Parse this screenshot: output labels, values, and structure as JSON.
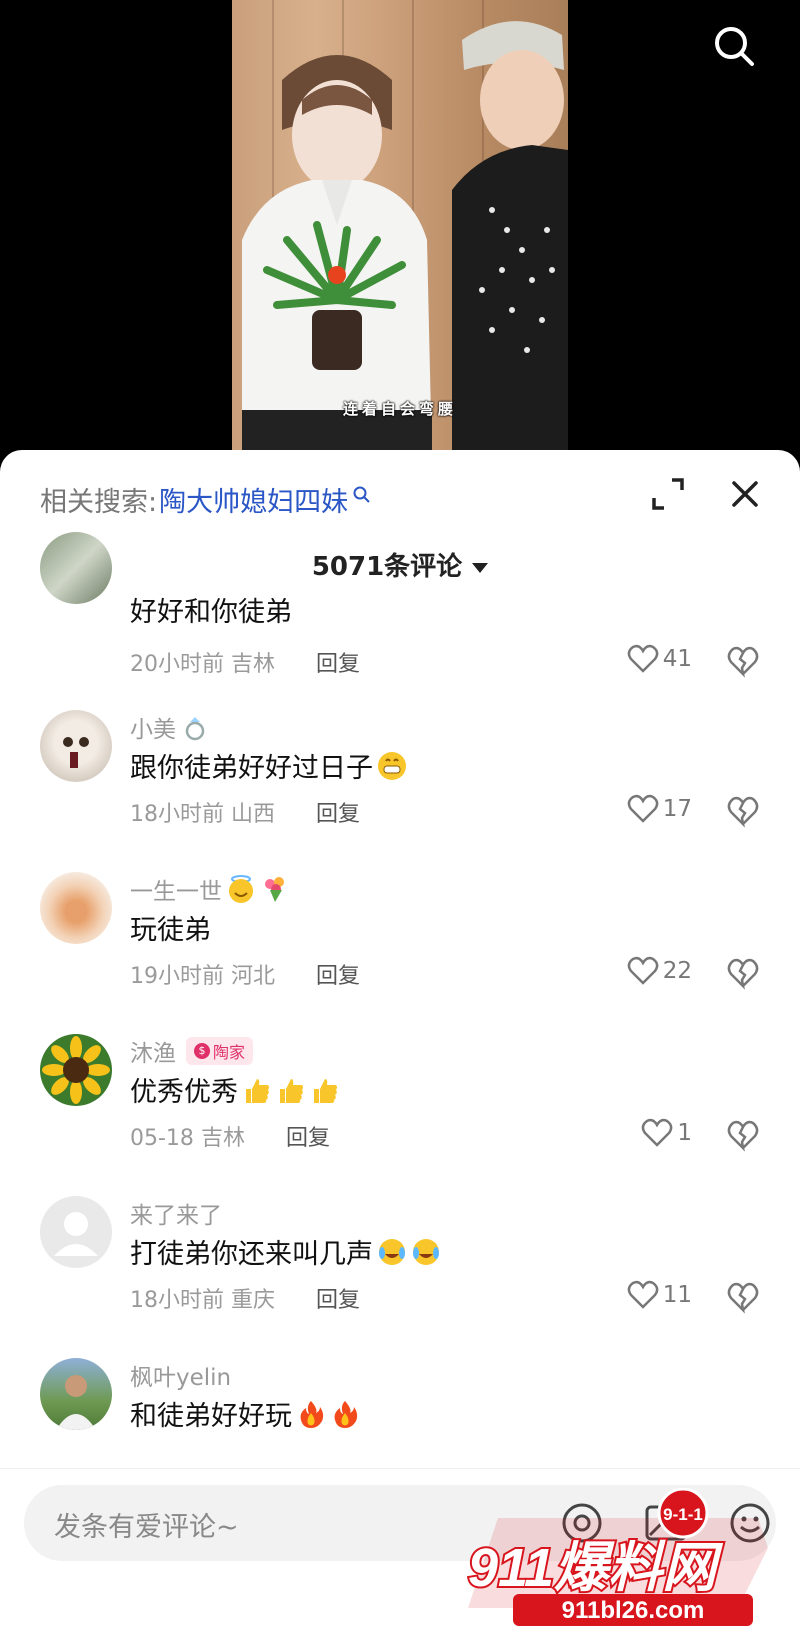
{
  "video": {
    "subtitle": "连着自会弯腰"
  },
  "panel": {
    "related_label": "相关搜索:",
    "related_query": "陶大帅媳妇四妹",
    "comment_count": "5071条评论"
  },
  "comments": [
    {
      "username": "",
      "text": "好好和你徒弟",
      "time": "20小时前",
      "location": "吉林",
      "reply": "回复",
      "likes": "41"
    },
    {
      "username": "小美",
      "text": "跟你徒弟好好过日子",
      "time": "18小时前",
      "location": "山西",
      "reply": "回复",
      "likes": "17"
    },
    {
      "username": "一生一世",
      "text": "玩徒弟",
      "time": "19小时前",
      "location": "河北",
      "reply": "回复",
      "likes": "22"
    },
    {
      "username": "沐渔",
      "badge": "陶家",
      "text": "优秀优秀",
      "time": "05-18",
      "location": "吉林",
      "reply": "回复",
      "likes": "1"
    },
    {
      "username": "来了来了",
      "text": "打徒弟你还来叫几声",
      "time": "18小时前",
      "location": "重庆",
      "reply": "回复",
      "likes": "11"
    },
    {
      "username": "枫叶yelin",
      "text": "和徒弟好好玩",
      "time": "",
      "location": "",
      "reply": "",
      "likes": ""
    }
  ],
  "input": {
    "placeholder": "发条有爱评论~"
  },
  "watermark": {
    "badge": "9-1-1",
    "brand": "911爆料网",
    "domain": "911bl26.com"
  },
  "colors": {
    "link": "#2a56c6",
    "badge": "#e0306a",
    "watermark_red": "#d8141c"
  },
  "icons": [
    "search-icon",
    "magnifier-icon",
    "expand-icon",
    "close-icon",
    "caret-down-icon",
    "heart-icon",
    "broken-heart-icon",
    "at-icon",
    "image-icon",
    "emoji-icon"
  ]
}
